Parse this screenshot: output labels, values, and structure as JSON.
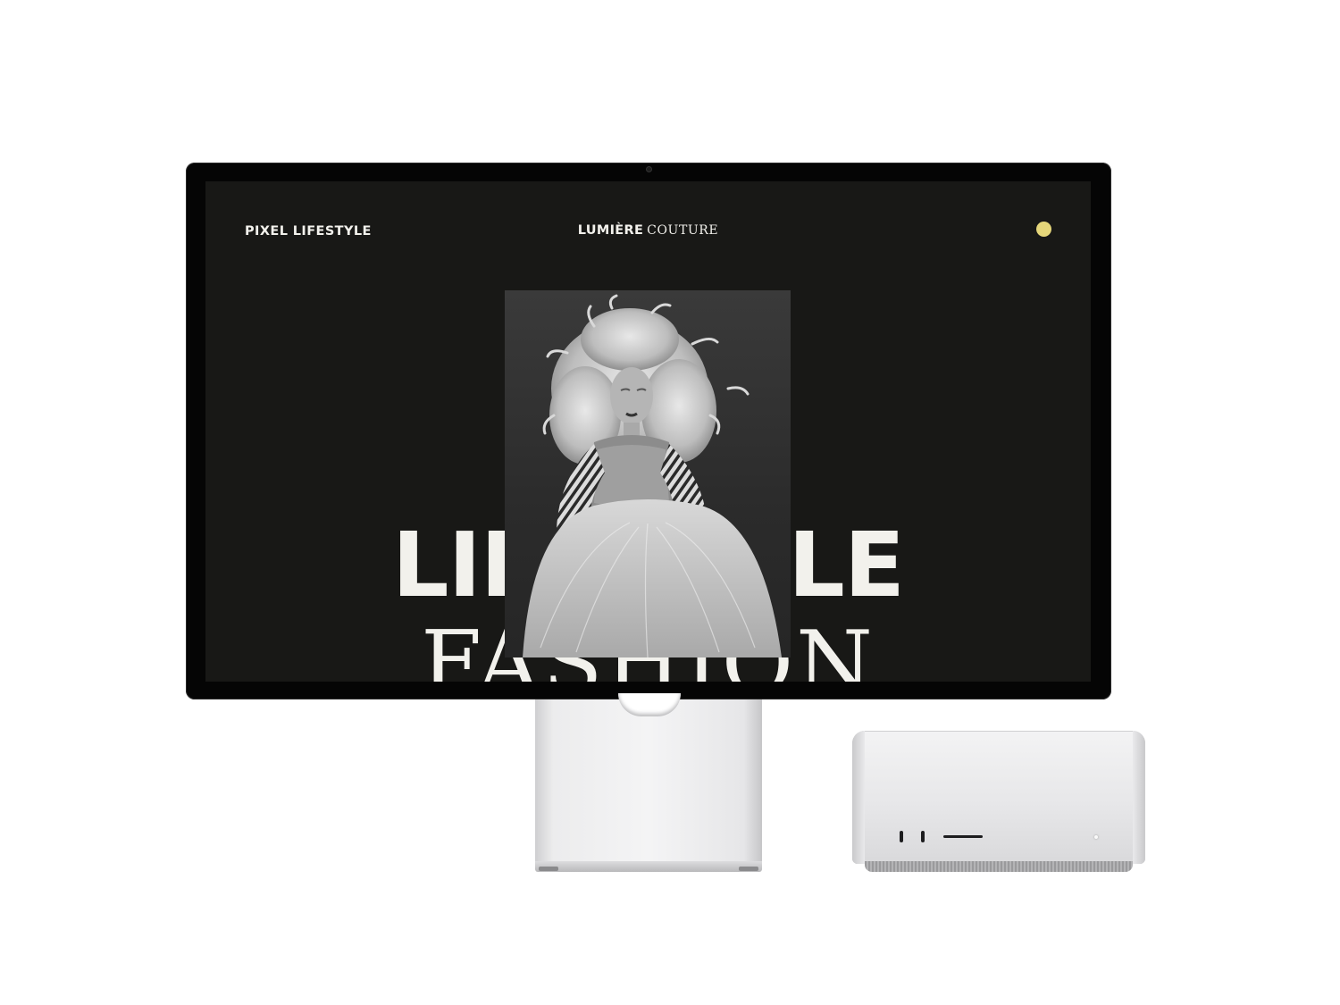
{
  "site": {
    "brand_left": "PIXEL LIFESTYLE",
    "brand_center_bold": "LUMIÈRE",
    "brand_center_light": "COUTURE",
    "hero_line1": "LIFESTYLE",
    "hero_line2": "FASHION",
    "menu_dot_color": "#e5d67a",
    "background_color": "#181816",
    "text_color": "#f2f1ec"
  },
  "hero_image": {
    "description_icon": "fashion-portrait-photo"
  }
}
